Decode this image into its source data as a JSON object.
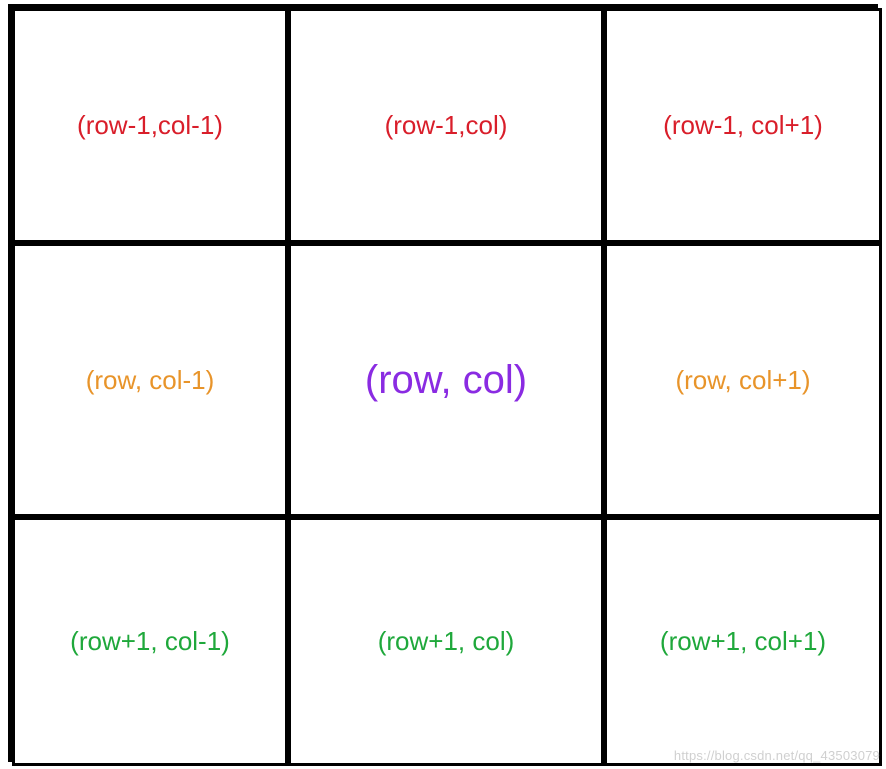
{
  "grid": {
    "r0c0": "(row-1,col-1)",
    "r0c1": "(row-1,col)",
    "r0c2": "(row-1, col+1)",
    "r1c0": "(row, col-1)",
    "r1c1": "(row, col)",
    "r1c2": "(row, col+1)",
    "r2c0": "(row+1, col-1)",
    "r2c1": "(row+1, col)",
    "r2c2": "(row+1, col+1)"
  },
  "colors": {
    "top_row": "#d91e2a",
    "mid_sides": "#e8942a",
    "center": "#8a2be2",
    "bottom_row": "#1fa83b"
  },
  "watermark": "https://blog.csdn.net/qq_43503079"
}
